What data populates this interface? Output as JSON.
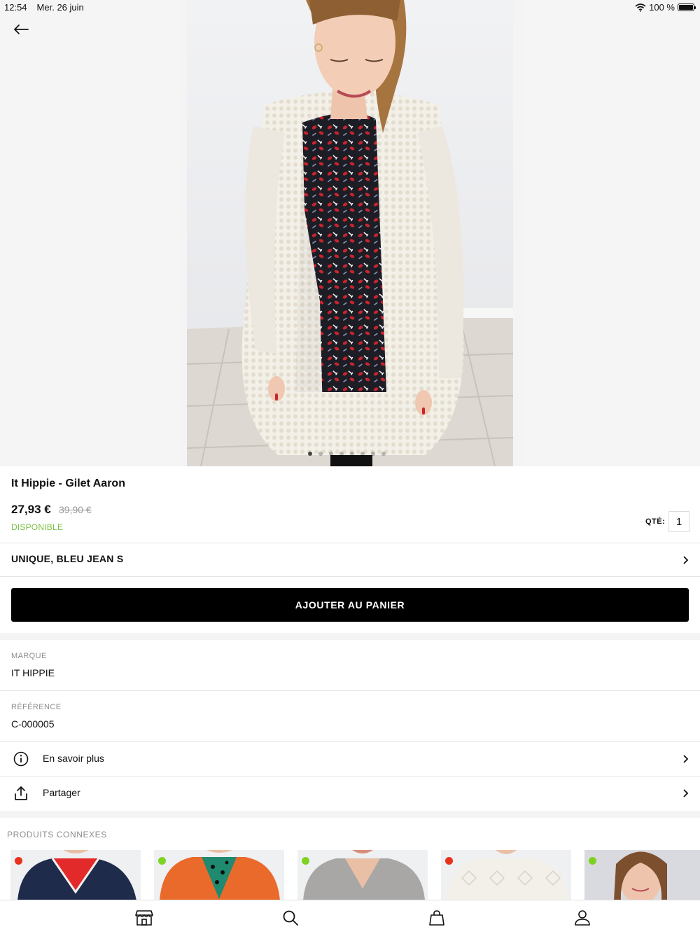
{
  "status_bar": {
    "time": "12:54",
    "date": "Mer. 26 juin",
    "battery": "100 %"
  },
  "gallery": {
    "image_count": 8,
    "active_index": 0
  },
  "product": {
    "title": "It Hippie - Gilet Aaron",
    "price": "27,93 €",
    "old_price": "39,90 €",
    "availability": "DISPONIBLE",
    "qty_label": "QTÉ:",
    "qty_value": "1",
    "variant": "UNIQUE, BLEU JEAN S",
    "add_to_cart": "AJOUTER AU PANIER"
  },
  "details": {
    "brand_label": "MARQUE",
    "brand_value": "IT HIPPIE",
    "reference_label": "RÉFÉRENCE",
    "reference_value": "C-000005"
  },
  "links": {
    "more_info": "En savoir plus",
    "share": "Partager"
  },
  "related": {
    "title": "PRODUITS CONNEXES",
    "items": [
      {
        "stock_color": "#e8321e"
      },
      {
        "stock_color": "#7ed321"
      },
      {
        "stock_color": "#7ed321"
      },
      {
        "stock_color": "#e8321e"
      },
      {
        "stock_color": "#7ed321"
      }
    ]
  },
  "colors": {
    "available_green": "#7ac142",
    "cta_bg": "#000000"
  },
  "tab_bar": {
    "icons": [
      "store-icon",
      "search-icon",
      "bag-icon",
      "profile-icon"
    ]
  }
}
